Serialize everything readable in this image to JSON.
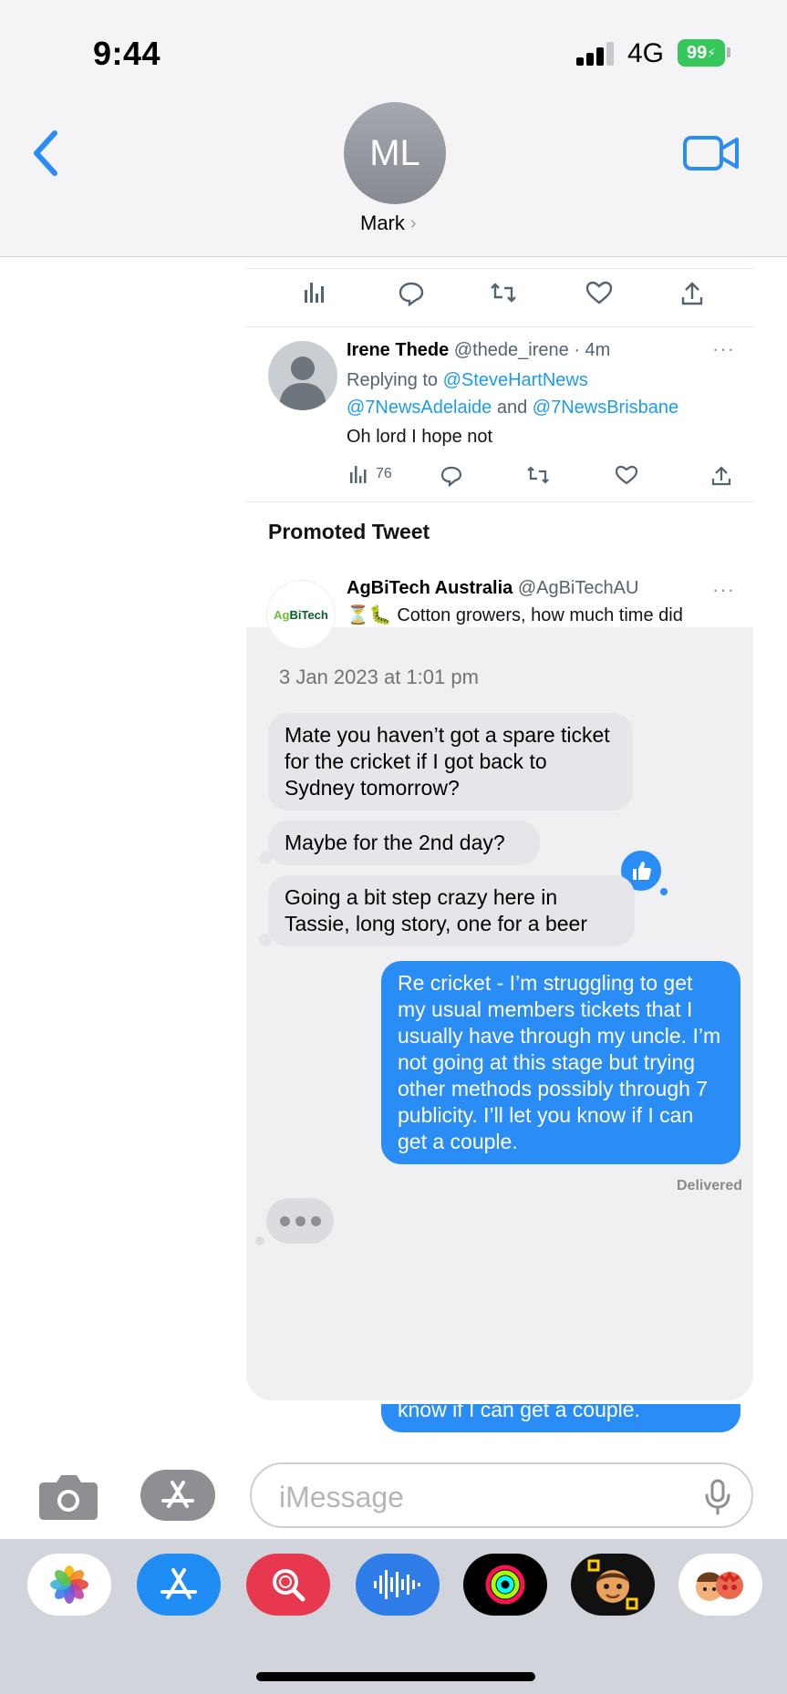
{
  "status_bar": {
    "time": "9:44",
    "network": "4G",
    "battery": "99"
  },
  "header": {
    "avatar_initials": "ML",
    "contact_name": "Mark",
    "chevron": "›"
  },
  "screenshot": {
    "tweet": {
      "name": "Irene Thede",
      "handle_time": "@thede_irene · 4m",
      "more": "···",
      "replying_prefix": "Replying to ",
      "replying_to_1": "@SteveHartNews",
      "replying_to_2": "@7NewsAdelaide",
      "replying_and": " and ",
      "replying_to_3": "@7NewsBrisbane",
      "text": "Oh lord I hope not",
      "views": "76"
    },
    "promoted_label": "Promoted Tweet",
    "promoted": {
      "logo_g": "Ag",
      "logo_b": "BiTech",
      "name": "AgBiTech Australia",
      "handle": "@AgBiTechAU",
      "more": "···",
      "text": "⏳🐛 Cotton growers, how much time did"
    },
    "date": "3 Jan 2023 at 1:01 pm",
    "messages": [
      {
        "dir": "in",
        "text": "Mate you haven’t got a spare ticket for the cricket if I got back to Sydney tomorrow?"
      },
      {
        "dir": "in",
        "text": "Maybe for the 2nd day?"
      },
      {
        "dir": "in",
        "text": "Going a bit step crazy here in Tassie, long story, one for a beer"
      },
      {
        "dir": "out",
        "text": "Re cricket - I’m struggling to get my usual members tickets that I usually have through my uncle. I’m not going at this stage but trying other methods possibly through 7 publicity. I’ll let you know if I can get a couple."
      }
    ],
    "delivered": "Delivered"
  },
  "peek_text": "know if I can get a couple.",
  "input": {
    "placeholder": "iMessage"
  },
  "drawer_apps": [
    "photos-app",
    "app-store",
    "images-search",
    "audio-message",
    "activity",
    "memoji",
    "animoji"
  ],
  "colors": {
    "blue": "#2a8df6",
    "incoming": "#e5e5ea",
    "twitter_blue": "#1d9bf0"
  }
}
